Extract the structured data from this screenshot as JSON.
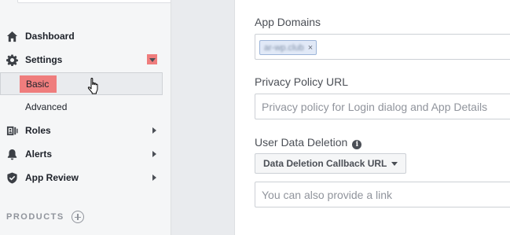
{
  "sidebar": {
    "items": [
      {
        "label": "Dashboard",
        "icon": "home-icon"
      },
      {
        "label": "Settings",
        "icon": "gear-icon"
      },
      {
        "label": "Roles",
        "icon": "user-badge-icon"
      },
      {
        "label": "Alerts",
        "icon": "bell-icon"
      },
      {
        "label": "App Review",
        "icon": "shield-check-icon"
      }
    ],
    "sub_items": [
      {
        "label": "Basic",
        "selected": true
      },
      {
        "label": "Advanced",
        "selected": false
      }
    ],
    "products_label": "PRODUCTS"
  },
  "main": {
    "app_domains": {
      "label": "App Domains",
      "token": "ar-wp.club",
      "token_remove": "×"
    },
    "privacy_policy": {
      "label": "Privacy Policy URL",
      "placeholder": "Privacy policy for Login dialog and App Details"
    },
    "data_deletion": {
      "label": "User Data Deletion",
      "info": "i",
      "dropdown_label": "Data Deletion Callback URL",
      "placeholder": "You can also provide a link"
    }
  },
  "colors": {
    "highlight": "#ef7d7d",
    "sidebar_bg": "#f5f6f7",
    "page_bg": "#e9ebee",
    "token_bg": "#e1e9f7"
  }
}
